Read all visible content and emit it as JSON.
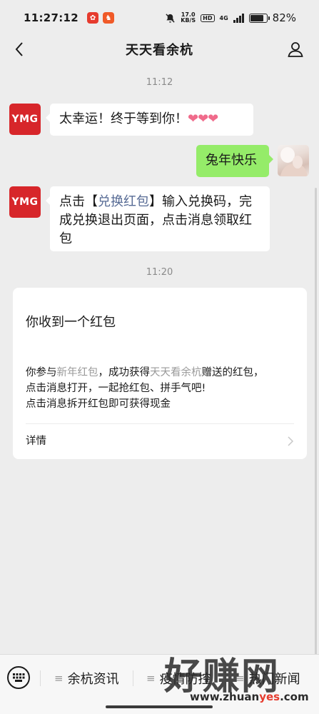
{
  "status_bar": {
    "time": "11:27:12",
    "net_speed_value": "17.0",
    "net_speed_unit": "KB/S",
    "hd": "HD",
    "network": "4G",
    "battery_percent": "82%",
    "battery_level": 0.82
  },
  "nav": {
    "title": "天天看余杭"
  },
  "chat": {
    "timestamp_1": "11:12",
    "timestamp_2": "11:20",
    "avatar_text": "YMG",
    "msg1_text": "太幸运！终于等到你！",
    "msg1_hearts": "❤❤❤",
    "msg2_text": "兔年快乐",
    "msg3_part1": "点击【",
    "msg3_link": "兑换红包",
    "msg3_part2": "】输入兑换码，完成兑换退出页面，点击消息领取红包"
  },
  "card": {
    "title": "你收到一个红包",
    "body_part1": "你参与",
    "body_link1": "新年红包",
    "body_part2": "，成功获得",
    "body_link2": "天天看余杭",
    "body_part3": "赠送的红包，",
    "body_line2": "点击消息打开，一起抢红包、拼手气吧!",
    "body_line3": "点击消息拆开红包即可获得现金",
    "detail_label": "详情"
  },
  "bottom_menu": {
    "items": [
      {
        "label": "余杭资讯"
      },
      {
        "label": "疫情防控"
      },
      {
        "label": "热门新闻"
      }
    ]
  },
  "watermark": {
    "big_text": "好赚网",
    "url_part1": "www.zhuan",
    "url_accent": "yes",
    "url_part2": ".com"
  }
}
